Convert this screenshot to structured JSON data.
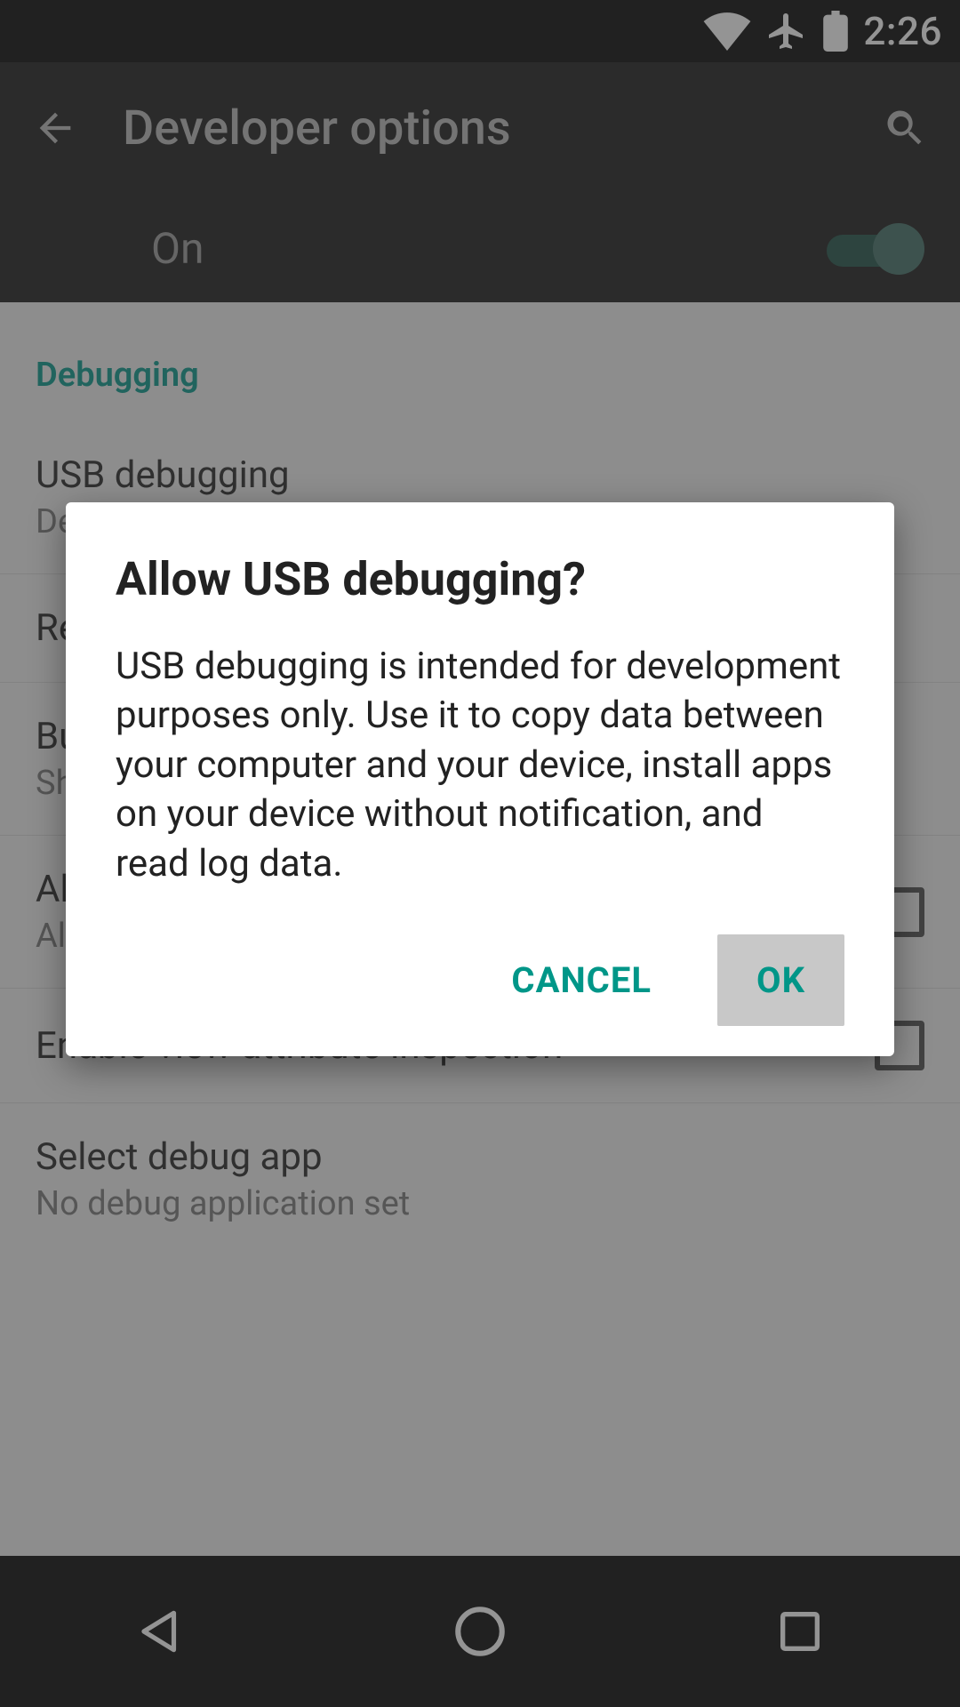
{
  "status": {
    "time": "2:26"
  },
  "appbar": {
    "title": "Developer options"
  },
  "master_toggle": {
    "label": "On",
    "enabled": true
  },
  "sections": {
    "debugging_header": "Debugging"
  },
  "items": {
    "usb_debugging": {
      "title": "USB debugging",
      "sub": "Debug mode when USB is connected"
    },
    "revoke": {
      "title": "Revoke USB debugging authorizations"
    },
    "bug_report": {
      "title": "Bug report shortcut",
      "sub": "Show a button in the power menu for taking a bug report"
    },
    "mock_locations": {
      "title": "Allow mock locations",
      "sub": "Allow mock locations"
    },
    "view_attr": {
      "title": "Enable view attribute inspection"
    },
    "debug_app": {
      "title": "Select debug app",
      "sub": "No debug application set"
    }
  },
  "dialog": {
    "title": "Allow USB debugging?",
    "body": "USB debugging is intended for development purposes only. Use it to copy data between your computer and your device, install apps on your device without notification, and read log data.",
    "cancel": "CANCEL",
    "ok": "OK"
  }
}
